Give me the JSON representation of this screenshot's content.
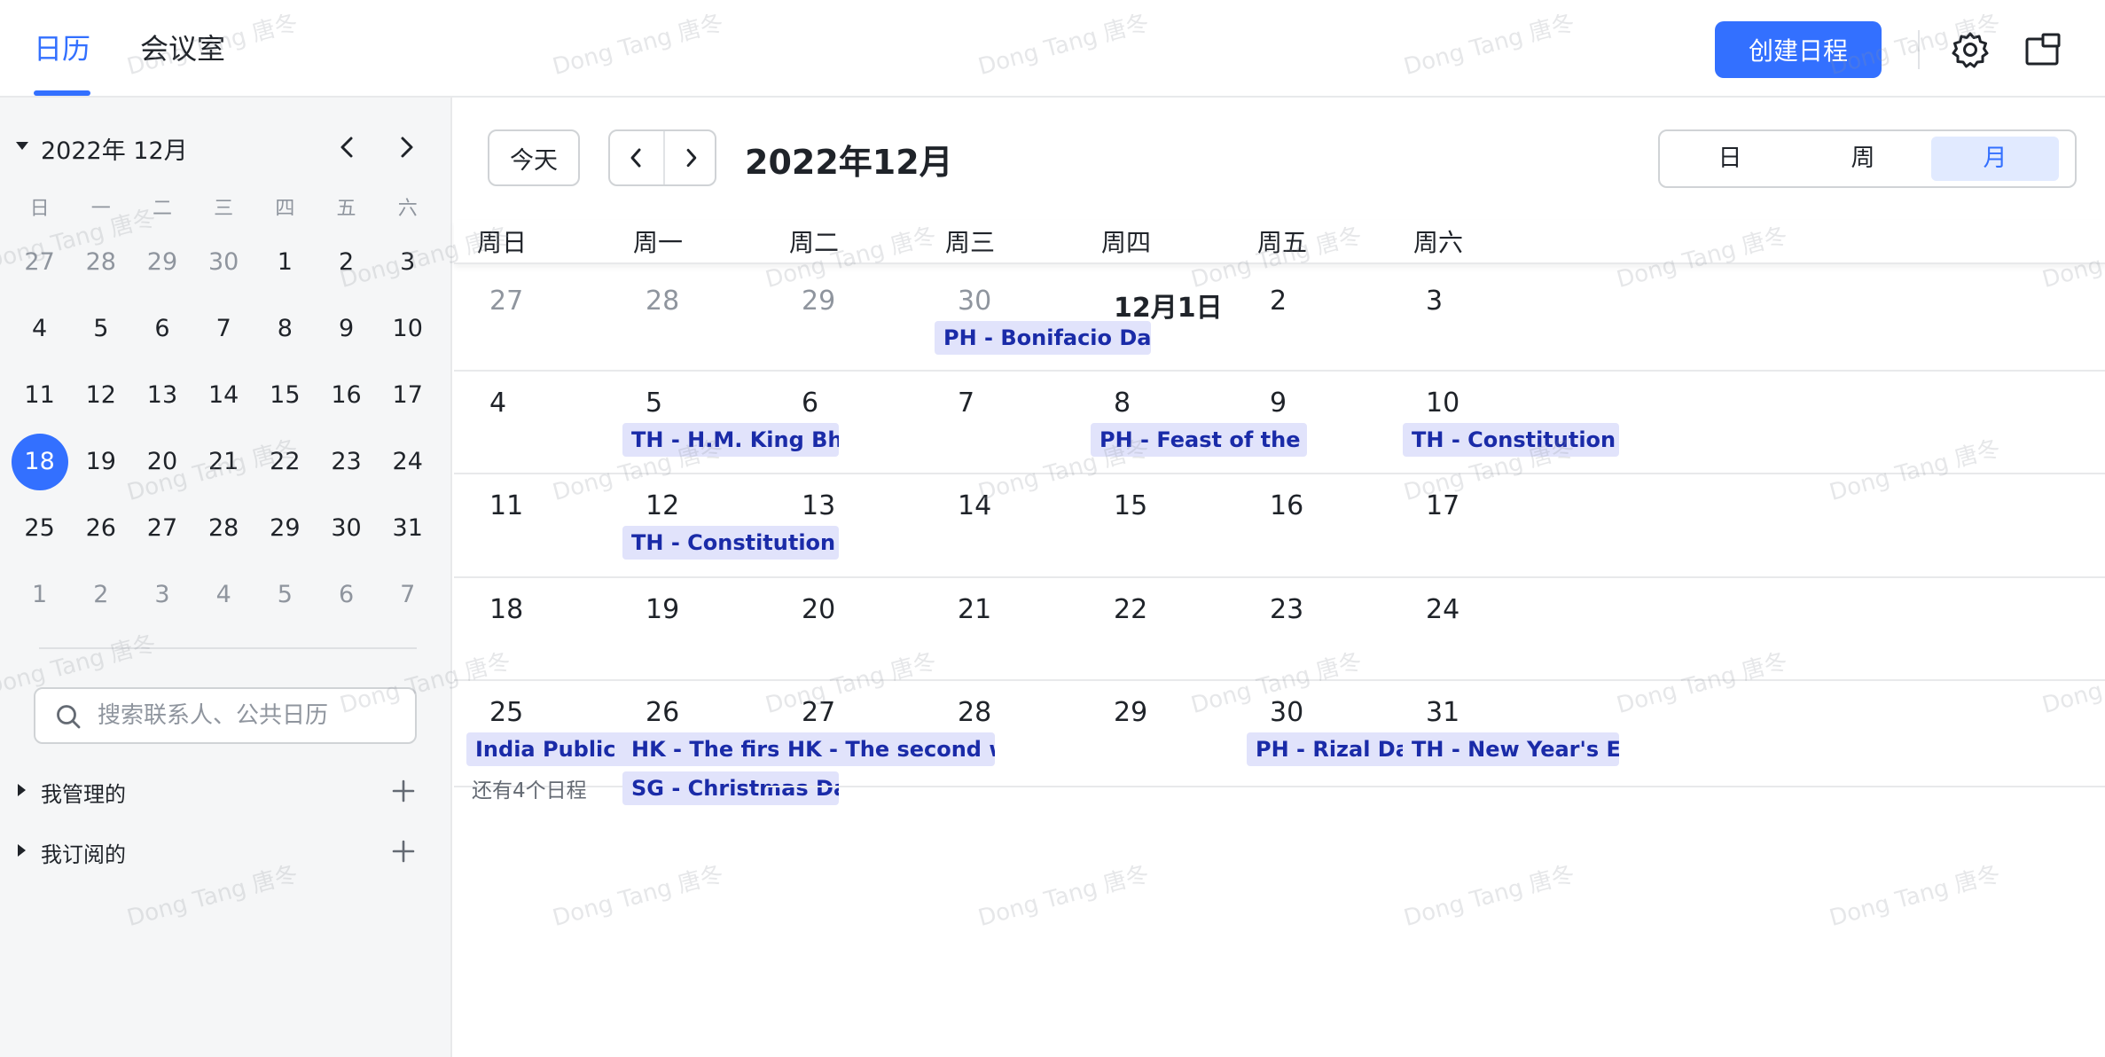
{
  "topbar": {
    "tabs": {
      "calendar": "日历",
      "meeting_rooms": "会议室"
    },
    "create_label": "创建日程"
  },
  "sidebar": {
    "mini_title": "2022年 12月",
    "weekdays": [
      "日",
      "一",
      "二",
      "三",
      "四",
      "五",
      "六"
    ],
    "weeks": [
      [
        "27",
        "28",
        "29",
        "30",
        "1",
        "2",
        "3"
      ],
      [
        "4",
        "5",
        "6",
        "7",
        "8",
        "9",
        "10"
      ],
      [
        "11",
        "12",
        "13",
        "14",
        "15",
        "16",
        "17"
      ],
      [
        "18",
        "19",
        "20",
        "21",
        "22",
        "23",
        "24"
      ],
      [
        "25",
        "26",
        "27",
        "28",
        "29",
        "30",
        "31"
      ],
      [
        "1",
        "2",
        "3",
        "4",
        "5",
        "6",
        "7"
      ]
    ],
    "selected_day": "18",
    "search_placeholder": "搜索联系人、公共日历",
    "groups": [
      "我管理的",
      "我订阅的"
    ]
  },
  "main": {
    "today_label": "今天",
    "month_title": "2022年12月",
    "views": {
      "day": "日",
      "week": "周",
      "month": "月"
    },
    "active_view": "month",
    "weekday_headers": [
      "周日",
      "周一",
      "周二",
      "周三",
      "周四",
      "周五",
      "周六"
    ],
    "weeks": [
      [
        {
          "n": "27",
          "dim": true,
          "events": []
        },
        {
          "n": "28",
          "dim": true,
          "events": []
        },
        {
          "n": "29",
          "dim": true,
          "events": []
        },
        {
          "n": "30",
          "dim": true,
          "events": [
            "PH - Bonifacio Day"
          ]
        },
        {
          "n": "12月1日",
          "bold": true,
          "events": []
        },
        {
          "n": "2",
          "events": []
        },
        {
          "n": "3",
          "events": []
        }
      ],
      [
        {
          "n": "4",
          "events": []
        },
        {
          "n": "5",
          "events": [
            "TH - H.M. King Bhumibol Adulyadej's Birthday"
          ]
        },
        {
          "n": "6",
          "events": []
        },
        {
          "n": "7",
          "events": []
        },
        {
          "n": "8",
          "events": [
            "PH - Feast of the Immaculate Conception"
          ]
        },
        {
          "n": "9",
          "events": []
        },
        {
          "n": "10",
          "events": [
            "TH - Constitution Day"
          ]
        }
      ],
      [
        {
          "n": "11",
          "events": []
        },
        {
          "n": "12",
          "events": [
            "TH - Constitution Day"
          ]
        },
        {
          "n": "13",
          "events": []
        },
        {
          "n": "14",
          "events": []
        },
        {
          "n": "15",
          "events": []
        },
        {
          "n": "16",
          "events": []
        },
        {
          "n": "17",
          "events": []
        }
      ],
      [
        {
          "n": "18",
          "events": []
        },
        {
          "n": "19",
          "events": []
        },
        {
          "n": "20",
          "events": []
        },
        {
          "n": "21",
          "events": []
        },
        {
          "n": "22",
          "events": []
        },
        {
          "n": "23",
          "events": []
        },
        {
          "n": "24",
          "events": []
        }
      ],
      [
        {
          "n": "25",
          "events": [
            "India Public Holiday"
          ],
          "more": "还有4个日程"
        },
        {
          "n": "26",
          "events": [
            "HK - The first weekday after Christmas Day",
            "SG - Christmas Day"
          ]
        },
        {
          "n": "27",
          "events": [
            "HK - The second weekday after Christmas Day"
          ]
        },
        {
          "n": "28",
          "events": []
        },
        {
          "n": "29",
          "events": []
        },
        {
          "n": "30",
          "events": [
            "PH - Rizal Day"
          ]
        },
        {
          "n": "31",
          "events": [
            "TH - New Year's Eve"
          ]
        }
      ]
    ]
  },
  "watermark": "Dong Tang 唐冬",
  "colors": {
    "accent": "#3370ff",
    "event_bg": "#e1e3fb",
    "event_text": "#1a2ba8"
  }
}
